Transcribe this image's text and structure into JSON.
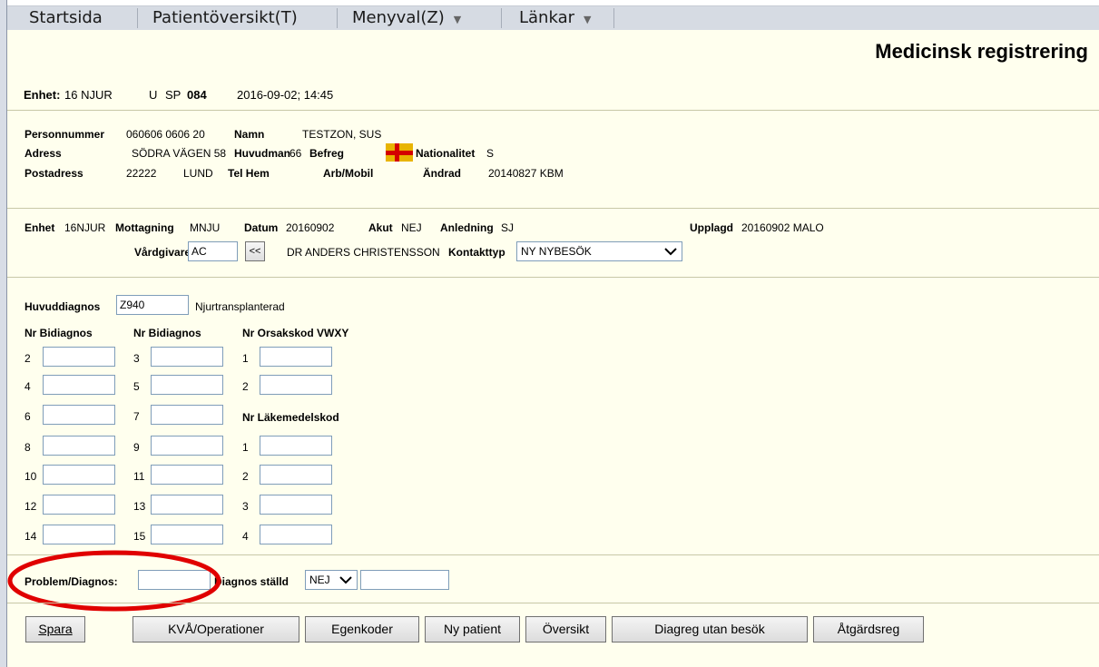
{
  "menu": {
    "items": [
      {
        "label": "Startsida"
      },
      {
        "label": "Patientöversikt(T)"
      },
      {
        "label": "Menyval(Z)"
      },
      {
        "label": "Länkar"
      }
    ]
  },
  "page_title": "Medicinsk registrering",
  "unit_line": {
    "enhet_label": "Enhet:",
    "enhet_value": "16 NJUR",
    "u": "U",
    "sp_label": "SP",
    "sp_value": "084",
    "datetime": "2016-09-02; 14:45"
  },
  "patient": {
    "personnummer_label": "Personnummer",
    "personnummer_value": "060606 0606  20",
    "namn_label": "Namn",
    "namn_value": "TESTZON, SUS",
    "adress_label": "Adress",
    "adress_value": "SÖDRA VÄGEN 58",
    "huvudman_label": "Huvudman",
    "huvudman_value": "66",
    "befreg_label": "Befreg",
    "nationalitet_label": "Nationalitet",
    "nationalitet_value": "S",
    "postadress_label": "Postadress",
    "postnummer_value": "22222",
    "ort_value": "LUND",
    "telhem_label": "Tel Hem",
    "arbmobil_label": "Arb/Mobil",
    "andrad_label": "Ändrad",
    "andrad_value": "20140827 KBM"
  },
  "visit": {
    "enhet_label": "Enhet",
    "enhet_value": "16NJUR",
    "mottagning_label": "Mottagning",
    "mottagning_value": "MNJU",
    "datum_label": "Datum",
    "datum_value": "20160902",
    "akut_label": "Akut",
    "akut_value": "NEJ",
    "anledning_label": "Anledning",
    "anledning_value": "SJ",
    "upplagd_label": "Upplagd",
    "upplagd_value": "20160902 MALO",
    "vardgivare_label": "Vårdgivare",
    "vardgivare_value": "AC",
    "lookup_button": "<<",
    "vardgivare_name": "DR ANDERS CHRISTENSSON",
    "kontakttyp_label": "Kontakttyp",
    "kontakttyp_value": "NY NYBESÖK"
  },
  "diagnosis": {
    "huvuddiagnos_label": "Huvuddiagnos",
    "huvuddiagnos_value": "Z940",
    "huvuddiagnos_text": "Njurtransplanterad",
    "col1_header": "Nr Bidiagnos",
    "col2_header": "Nr Bidiagnos",
    "orsak_header": "Nr Orsakskod VWXY",
    "lakemedel_header": "Nr Läkemedelskod",
    "col1_numbers": [
      "2",
      "4",
      "6",
      "8",
      "10",
      "12",
      "14"
    ],
    "col2_numbers": [
      "3",
      "5",
      "7",
      "9",
      "11",
      "13",
      "15"
    ],
    "orsak_numbers": [
      "1",
      "2"
    ],
    "lakemedel_numbers": [
      "1",
      "2",
      "3",
      "4"
    ]
  },
  "problem": {
    "label": "Problem/Diagnos:",
    "diagnos_stalld_label": "Diagnos ställd",
    "diagnos_stalld_value": "NEJ"
  },
  "buttons": {
    "spara": "Spara",
    "kva": "KVÅ/Operationer",
    "egenkoder": "Egenkoder",
    "ny_patient": "Ny patient",
    "oversikt": "Översikt",
    "diagreg": "Diagreg utan besök",
    "atgardsreg": "Åtgärdsreg"
  },
  "colors": {
    "panel_bg": "#ffffee",
    "annotation": "#e00000",
    "flag_yellow": "#e8b400",
    "flag_red": "#d40000"
  }
}
